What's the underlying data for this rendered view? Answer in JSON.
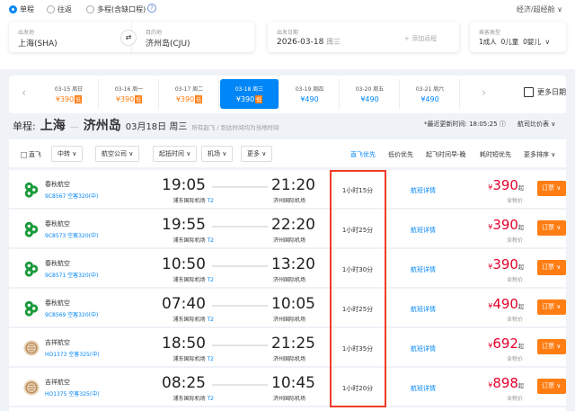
{
  "trip_types": [
    "单程",
    "往返",
    "多程(含缺口程)"
  ],
  "cabin": "经济/超经舱 ∨",
  "search": {
    "from_label": "出发地",
    "from": "上海(SHA)",
    "to_label": "目的地",
    "to": "济州岛(CJU)",
    "date_label": "出发日期",
    "date": "2026-03-18",
    "weekday": "周三",
    "add_trip": "+ 添加返程",
    "pax_label": "乘客类型",
    "pax": "1成人  0儿童  0婴儿  ∨"
  },
  "date_strip": [
    {
      "date": "03-15 周日",
      "price": "¥390",
      "tag": "低"
    },
    {
      "date": "03-16 周一",
      "price": "¥390",
      "tag": "低"
    },
    {
      "date": "03-17 周二",
      "price": "¥390",
      "tag": "低"
    },
    {
      "date": "03-18 周三",
      "price": "¥390",
      "tag": "低"
    },
    {
      "date": "03-19 周四",
      "price": "¥490",
      "tag": ""
    },
    {
      "date": "03-20 周五",
      "price": "¥490",
      "tag": ""
    },
    {
      "date": "03-21 周六",
      "price": "¥490",
      "tag": ""
    }
  ],
  "more_dates": "更多日期",
  "heading": {
    "type": "单程:",
    "from": "上海",
    "to": "济州岛",
    "date": "03月18日 周三",
    "note": "所有起飞 / 到达时间均为当地时间",
    "updated": "*最近更新时间: 18:05:25 ⓘ",
    "compare": "航司比价表 ∨"
  },
  "filters": {
    "direct": "直飞",
    "dropdowns": [
      "中转 ∨",
      "航空公司 ∨",
      "起抵时间 ∨",
      "机场 ∨",
      "更多 ∨"
    ],
    "sorts": [
      "直飞优先",
      "低价优先",
      "起飞时间早-晚",
      "耗时短优先",
      "更多排序 ∨"
    ]
  },
  "accent": "#0086f6",
  "flights": [
    {
      "airline": "春秋航空",
      "flight": "9C8567 空客320(中)",
      "dep": "19:05",
      "dep_airport": "浦东国际机场",
      "dep_term": "T2",
      "arr": "21:20",
      "arr_airport": "济州国际机场",
      "duration": "1小时15分",
      "details": "航班详情",
      "price": "390",
      "qi": "起",
      "tax": "含税价",
      "book": "订票 ∨",
      "logo": "spring"
    },
    {
      "airline": "春秋航空",
      "flight": "9C8573 空客320(中)",
      "dep": "19:55",
      "dep_airport": "浦东国际机场",
      "dep_term": "T2",
      "arr": "22:20",
      "arr_airport": "济州国际机场",
      "duration": "1小时25分",
      "details": "航班详情",
      "price": "390",
      "qi": "起",
      "tax": "含税价",
      "book": "订票 ∨",
      "logo": "spring"
    },
    {
      "airline": "春秋航空",
      "flight": "9C8571 空客320(中)",
      "dep": "10:50",
      "dep_airport": "浦东国际机场",
      "dep_term": "T2",
      "arr": "13:20",
      "arr_airport": "济州国际机场",
      "duration": "1小时30分",
      "details": "航班详情",
      "price": "390",
      "qi": "起",
      "tax": "含税价",
      "book": "订票 ∨",
      "logo": "spring"
    },
    {
      "airline": "春秋航空",
      "flight": "9C8569 空客320(中)",
      "dep": "07:40",
      "dep_airport": "浦东国际机场",
      "dep_term": "T2",
      "arr": "10:05",
      "arr_airport": "济州国际机场",
      "duration": "1小时25分",
      "details": "航班详情",
      "price": "490",
      "qi": "起",
      "tax": "含税价",
      "book": "订票 ∨",
      "logo": "spring"
    },
    {
      "airline": "吉祥航空",
      "flight": "HO1373 空客325(中)",
      "dep": "18:50",
      "dep_airport": "浦东国际机场",
      "dep_term": "T2",
      "arr": "21:25",
      "arr_airport": "济州国际机场",
      "duration": "1小时35分",
      "details": "航班详情",
      "price": "692",
      "qi": "起",
      "tax": "含税价",
      "book": "订票 ∨",
      "logo": "juneyao"
    },
    {
      "airline": "吉祥航空",
      "flight": "HO1375 空客325(中)",
      "dep": "08:25",
      "dep_airport": "浦东国际机场",
      "dep_term": "T2",
      "arr": "10:45",
      "arr_airport": "济州国际机场",
      "duration": "1小时20分",
      "details": "航班详情",
      "price": "898",
      "qi": "起",
      "tax": "含税价",
      "book": "订票 ∨",
      "logo": "juneyao"
    }
  ]
}
